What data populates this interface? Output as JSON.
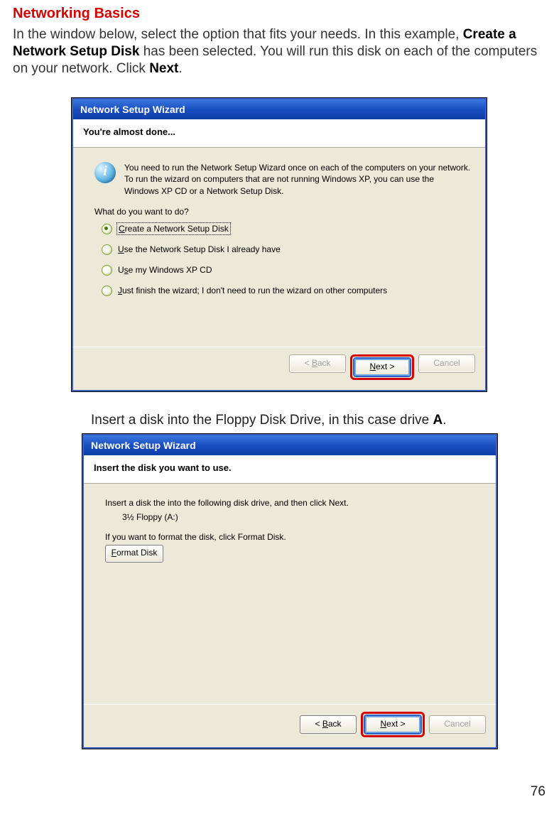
{
  "page": {
    "heading": "Networking Basics",
    "intro_pre": "In the window below, select the option that fits your needs. In this example, ",
    "intro_bold1": "Create a Network Setup Disk",
    "intro_mid": " has been selected. You will run this disk on each of the computers on your network. Click ",
    "intro_bold2": "Next",
    "intro_end": ".",
    "mid_caption_pre": "Insert a disk into the Floppy Disk Drive, in this case drive ",
    "mid_caption_bold": "A",
    "mid_caption_end": ".",
    "page_number": "76"
  },
  "wizard1": {
    "title": "Network Setup Wizard",
    "header": "You're almost done...",
    "info_text": "You need to run the Network Setup Wizard once on each of the computers on your network. To run the wizard on computers that are not running Windows XP, you can use the Windows XP CD or a Network Setup Disk.",
    "prompt": "What do you want to do?",
    "options": [
      {
        "u": "C",
        "rest": "reate a Network Setup Disk",
        "selected": true
      },
      {
        "u": "U",
        "rest": "se the Network Setup Disk I already have",
        "selected": false
      },
      {
        "u": "U",
        "rest2": "s",
        "rest": "e my Windows XP CD",
        "selected": false,
        "u2": true
      },
      {
        "u": "J",
        "rest": "ust finish the wizard; I don't need to run the wizard on other computers",
        "selected": false
      }
    ],
    "buttons": {
      "back_u": "B",
      "back_rest": "ack",
      "back_prefix": "< ",
      "next_u": "N",
      "next_rest": "ext >",
      "cancel": "Cancel"
    }
  },
  "wizard2": {
    "title": "Network Setup Wizard",
    "header": "Insert the disk you want to use.",
    "line1": "Insert a disk the into the following disk drive, and then click Next.",
    "drive": "3½ Floppy (A:)",
    "line2": "If you want to format the disk, click Format Disk.",
    "format_u": "F",
    "format_rest": "ormat Disk",
    "buttons": {
      "back_u": "B",
      "back_rest": "ack",
      "back_prefix": "< ",
      "next_u": "N",
      "next_rest": "ext >",
      "cancel": "Cancel"
    }
  }
}
